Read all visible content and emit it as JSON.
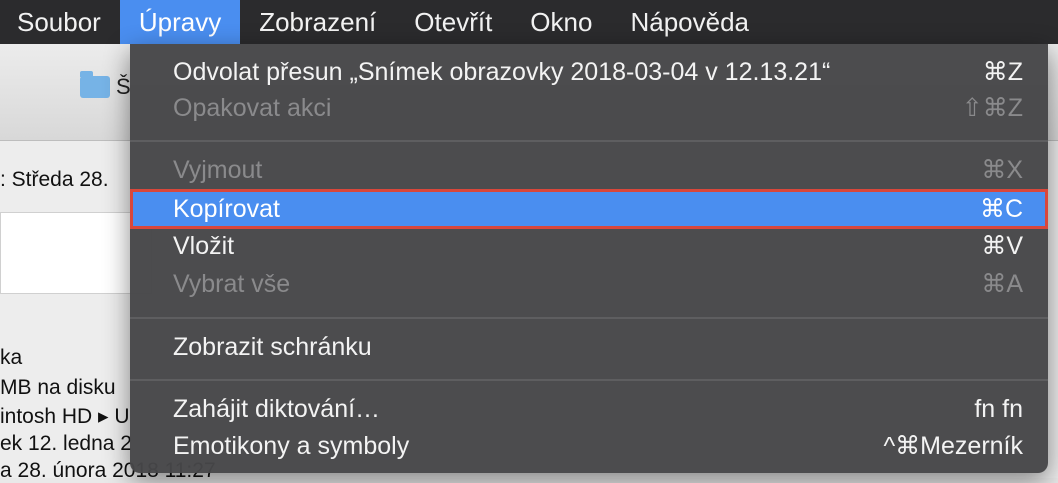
{
  "menubar": {
    "items": [
      "Soubor",
      "Úpravy",
      "Zobrazení",
      "Otevřít",
      "Okno",
      "Nápověda"
    ]
  },
  "background_window": {
    "folder_name": "Š",
    "lines": [
      ": Středa 28. ",
      "ka",
      " MB na disku",
      "intosh HD ▸ U",
      "ek 12. ledna 2",
      "a 28. února 2018 11:27"
    ]
  },
  "edit_menu": {
    "items": [
      {
        "label": "Odvolat přesun „Snímek obrazovky 2018-03-04 v 12.13.21“",
        "shortcut": "⌘Z",
        "enabled": true
      },
      {
        "label": "Opakovat akci",
        "shortcut": "⇧⌘Z",
        "enabled": false
      },
      {
        "label": "Vyjmout",
        "shortcut": "⌘X",
        "enabled": false
      },
      {
        "label": "Kopírovat",
        "shortcut": "⌘C",
        "enabled": true,
        "highlighted": true
      },
      {
        "label": "Vložit",
        "shortcut": "⌘V",
        "enabled": true
      },
      {
        "label": "Vybrat vše",
        "shortcut": "⌘A",
        "enabled": false
      },
      {
        "label": "Zobrazit schránku",
        "shortcut": "",
        "enabled": true
      },
      {
        "label": "Zahájit diktování…",
        "shortcut": "fn fn",
        "enabled": true
      },
      {
        "label": "Emotikony a symboly",
        "shortcut": "^⌘Mezerník",
        "enabled": true
      }
    ]
  },
  "colors": {
    "menubar_bg": "#2b2b2d",
    "highlight": "#4a8ef0",
    "callout_border": "#d9473b",
    "menu_bg": "#464648"
  }
}
